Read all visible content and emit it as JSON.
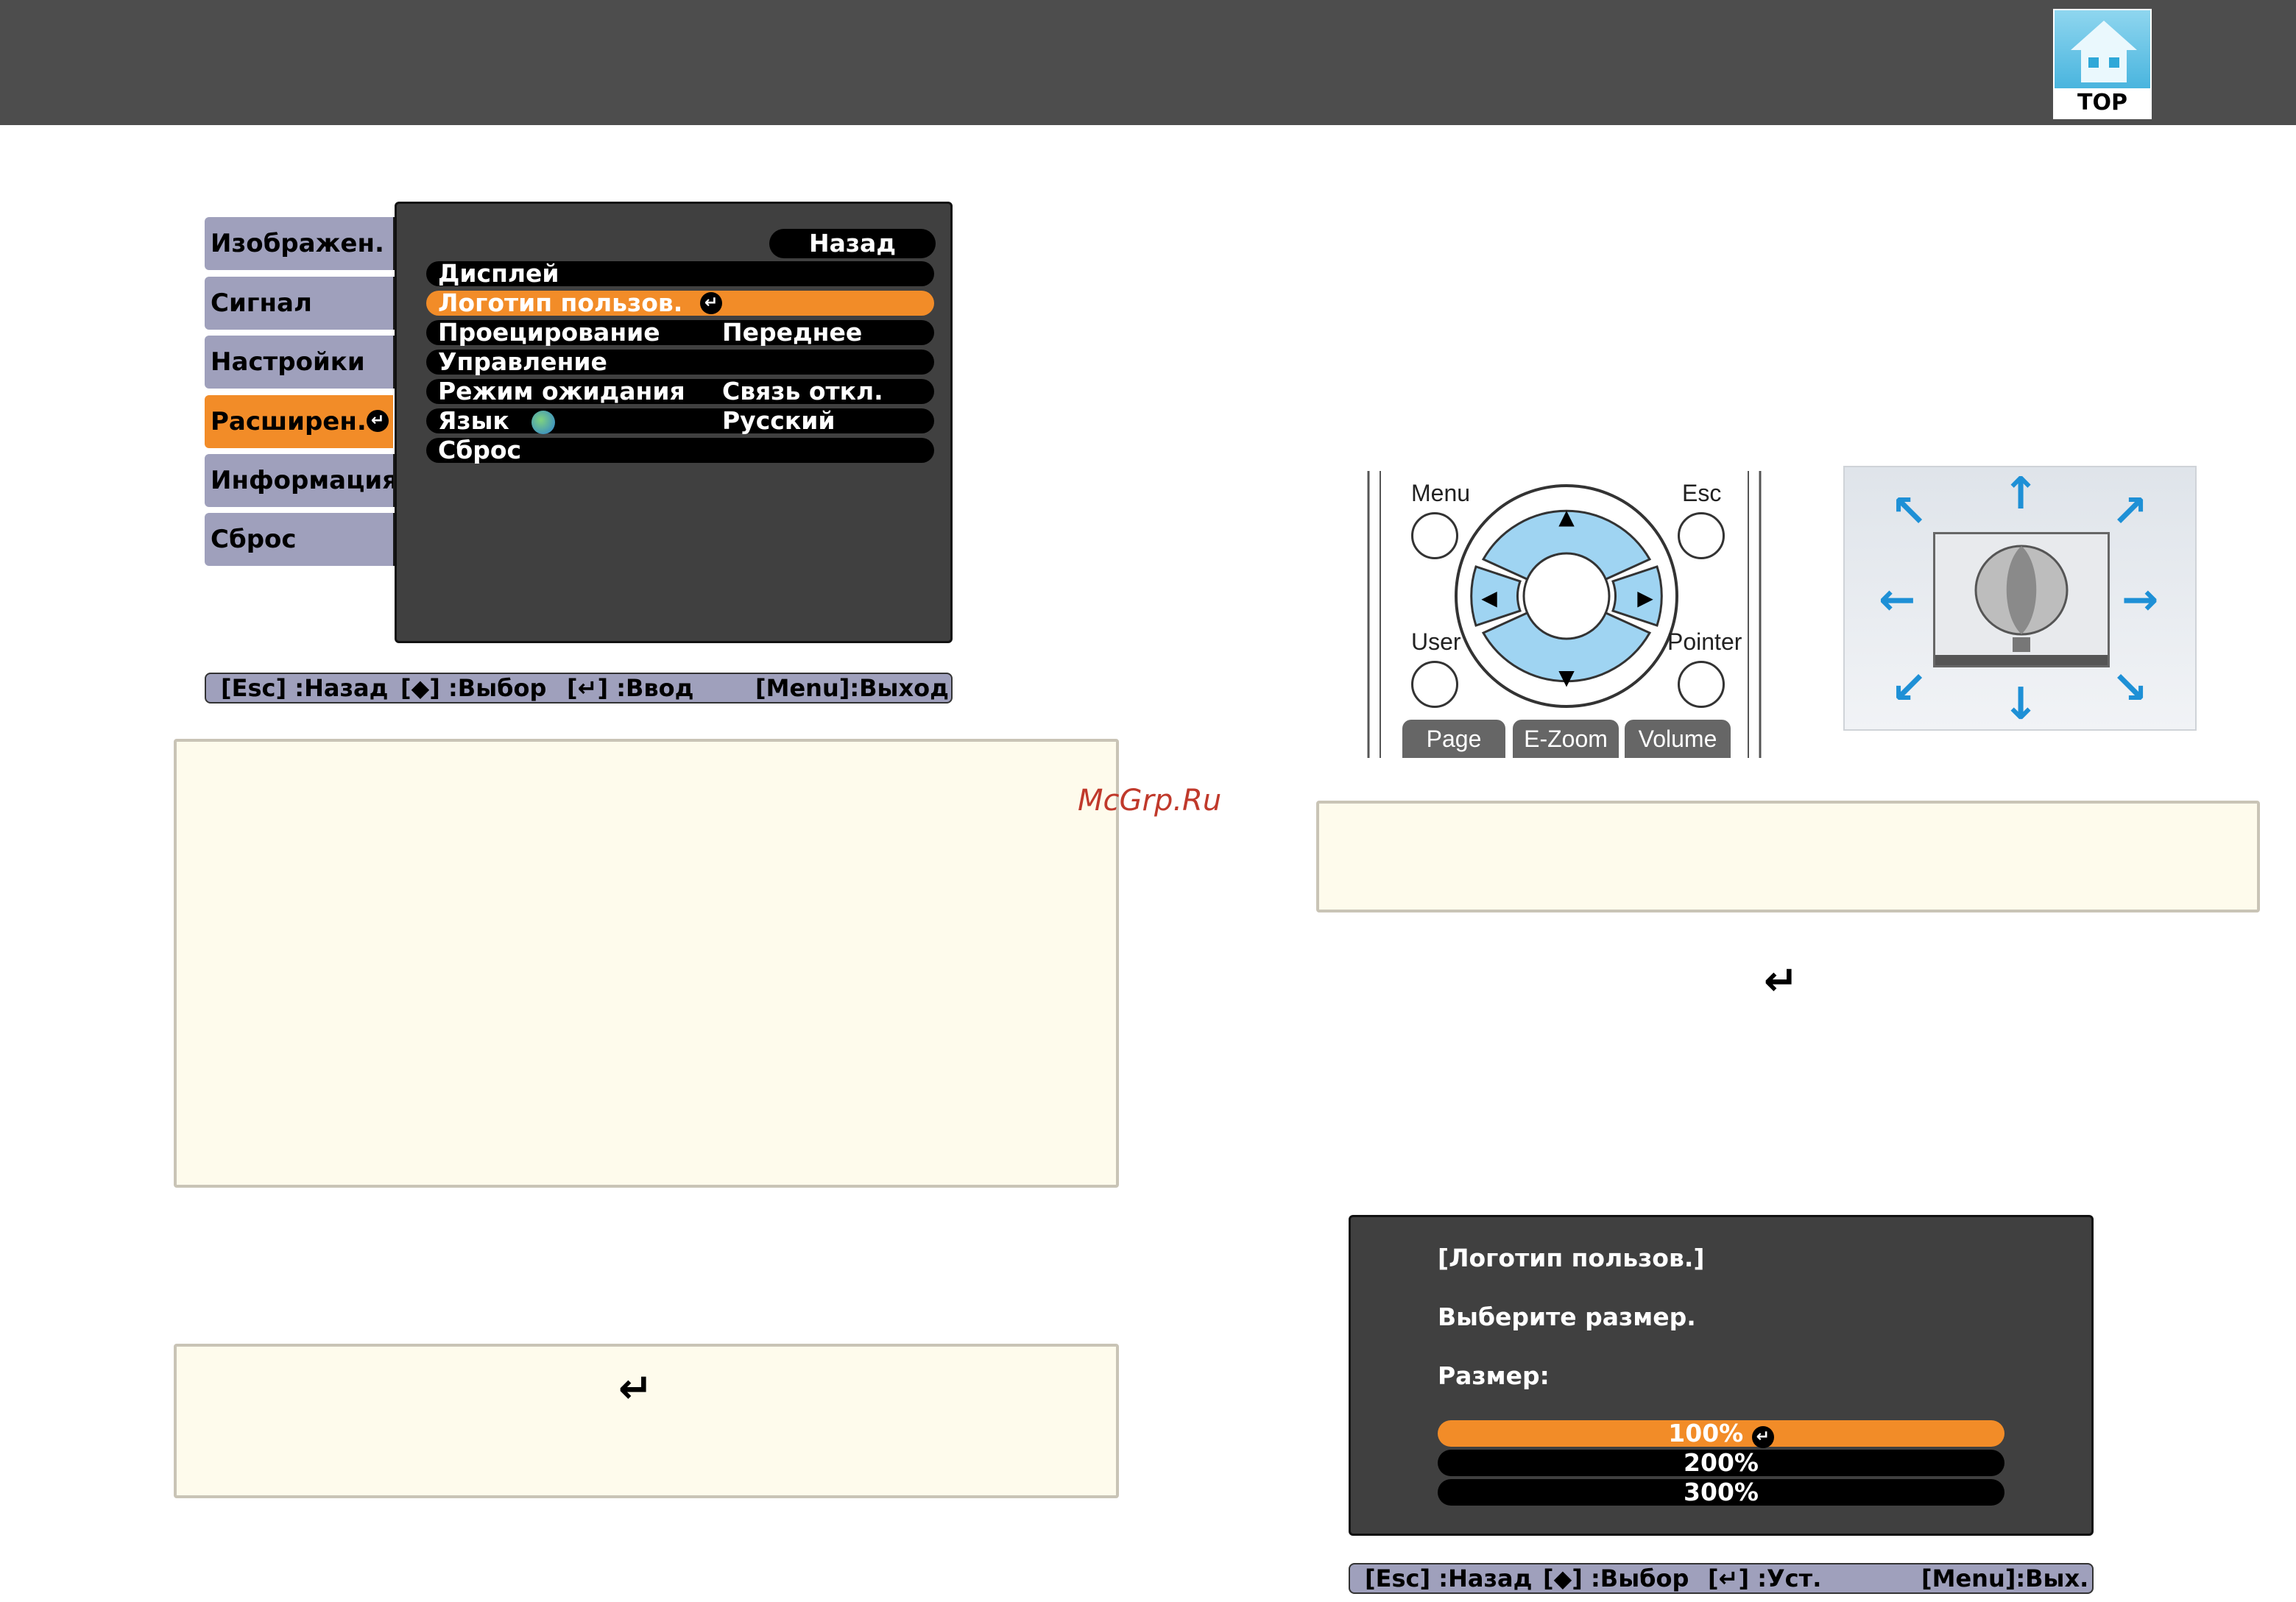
{
  "header": {
    "top_button_label": "TOP"
  },
  "menu_screen": {
    "tabs": [
      {
        "label": "Изображен."
      },
      {
        "label": "Сигнал"
      },
      {
        "label": "Настройки"
      },
      {
        "label": "Расширен."
      },
      {
        "label": "Информация"
      },
      {
        "label": "Сброс"
      }
    ],
    "back_label": "Назад",
    "items": [
      {
        "label": "Дисплей",
        "value": ""
      },
      {
        "label": "Логотип пользов.",
        "value": ""
      },
      {
        "label": "Проецирование",
        "value": "Переднее"
      },
      {
        "label": "Управление",
        "value": ""
      },
      {
        "label": "Режим ожидания",
        "value": "Связь откл."
      },
      {
        "label": "Язык",
        "value": "Русский"
      },
      {
        "label": "Сброс",
        "value": ""
      }
    ],
    "hints": {
      "esc": "[Esc] :Назад",
      "select": "[◆] :Выбор",
      "enter": "[↵] :Ввод",
      "menu": "[Menu]:Выход"
    }
  },
  "watermark": "McGrp.Ru",
  "remote": {
    "menu_label": "Menu",
    "esc_label": "Esc",
    "user_label": "User",
    "pointer_label": "Pointer",
    "page_label": "Page",
    "ezoom_label": "E-Zoom",
    "volume_label": "Volume"
  },
  "size_dialog": {
    "title": "[Логотип пользов.]",
    "prompt": "Выберите размер.",
    "size_label": "Размер:",
    "options": [
      "100%",
      "200%",
      "300%"
    ],
    "hints": {
      "esc": "[Esc] :Назад",
      "select": "[◆] :Выбор",
      "set": "[↵] :Уст.",
      "menu": "[Menu]:Вых."
    }
  }
}
